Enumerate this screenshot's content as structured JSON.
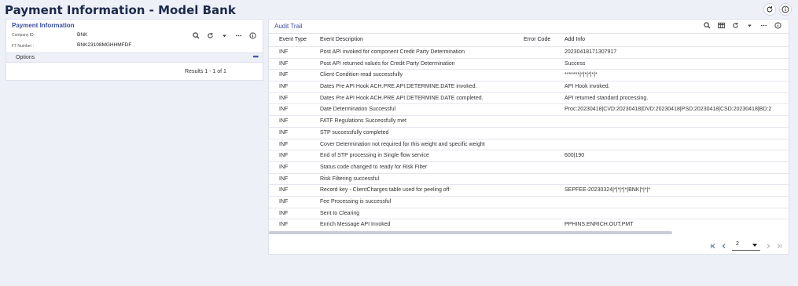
{
  "page": {
    "title": "Payment Information - Model Bank"
  },
  "left_panel": {
    "title": "Payment Information",
    "fields": [
      {
        "label": "Company ID :",
        "value": "BNK"
      },
      {
        "label": "FT Number :",
        "value": "BNK23108MGHHMFDF"
      }
    ],
    "options_label": "Options",
    "results": "Results 1 - 1 of 1"
  },
  "audit": {
    "title": "Audit Trail",
    "columns": [
      "Event Type",
      "Event Description",
      "Error Code",
      "Add Info"
    ],
    "rows": [
      {
        "type": "INF",
        "desc": "Post API invoked for component Credit Party Determination",
        "code": "",
        "info": "20230418171307917"
      },
      {
        "type": "INF",
        "desc": "Post API returned values for Credit Party Determination",
        "code": "",
        "info": "Success"
      },
      {
        "type": "INF",
        "desc": "Client Condition read successfully",
        "code": "",
        "info": "*******|*|*|*|*|*"
      },
      {
        "type": "INF",
        "desc": "Dates Pre API Hook ACH.PRE.API.DETERMINE.DATE invoked.",
        "code": "",
        "info": "API Hook invoked."
      },
      {
        "type": "INF",
        "desc": "Dates Pre API Hook ACH.PRE.API.DETERMINE.DATE completed.",
        "code": "",
        "info": "API returned standard processing."
      },
      {
        "type": "INF",
        "desc": "Date Determination Successful",
        "code": "",
        "info": "Proc:20230418|CVD:20230418|DVD:20230418|PSD:20230418|CSD:20230418|BD:2"
      },
      {
        "type": "INF",
        "desc": "FATF Regulations Successfully met",
        "code": "",
        "info": ""
      },
      {
        "type": "INF",
        "desc": "STP successfully completed",
        "code": "",
        "info": ""
      },
      {
        "type": "INF",
        "desc": "Cover Determination not required for this weight and specific weight",
        "code": "",
        "info": ""
      },
      {
        "type": "INF",
        "desc": "End of STP processing in Single flow service",
        "code": "",
        "info": "600|190"
      },
      {
        "type": "INF",
        "desc": "Status code changed to ready for Risk Filter",
        "code": "",
        "info": ""
      },
      {
        "type": "INF",
        "desc": "Risk Filtering successful",
        "code": "",
        "info": ""
      },
      {
        "type": "INF",
        "desc": "Record key - ClientCharges table used for peeling off",
        "code": "",
        "info": "SEPFEE-20230324|*|*|*|*|BNK|*|*|*"
      },
      {
        "type": "INF",
        "desc": "Fee Processing is successful",
        "code": "",
        "info": ""
      },
      {
        "type": "INF",
        "desc": "Sent to Clearing",
        "code": "",
        "info": ""
      },
      {
        "type": "INF",
        "desc": "Enrich Message API Invoked",
        "code": "",
        "info": "PPHINS.ENRICH.OUT.PMT"
      }
    ],
    "pager": {
      "page": "2"
    }
  },
  "icons": {
    "refresh": "refresh-icon",
    "info": "info-icon",
    "search": "search-icon",
    "more": "more-icon",
    "columns": "columns-icon",
    "chevron_down": "chevron-down-icon"
  },
  "colors": {
    "accent": "#3b4ea5",
    "title": "#1c2a4a",
    "background": "#eef0f8"
  }
}
